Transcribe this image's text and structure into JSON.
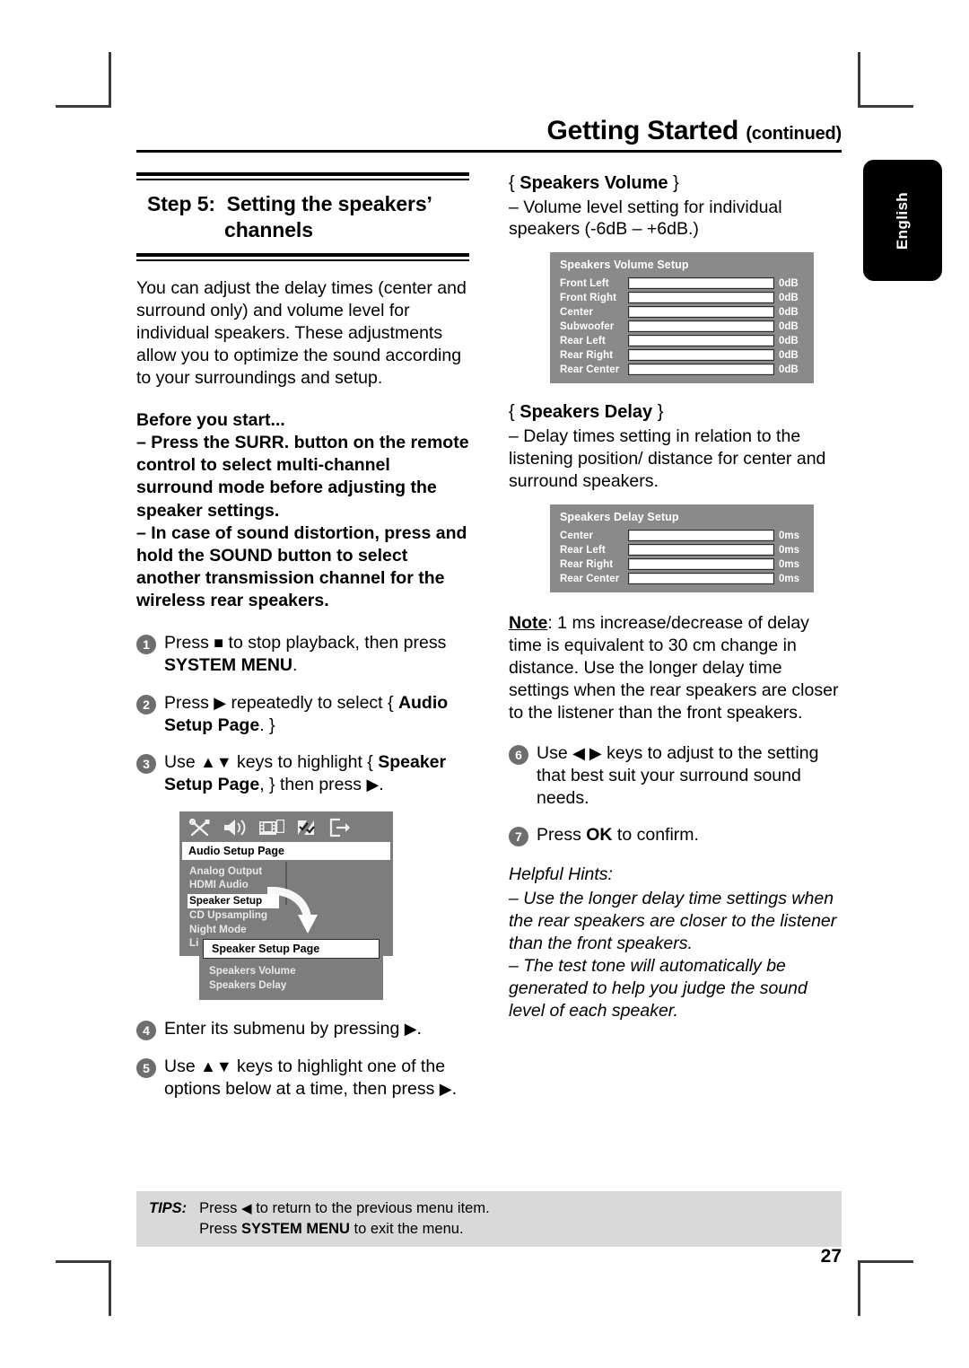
{
  "header": {
    "title": "Getting Started",
    "continued": "(continued)"
  },
  "language_tab": {
    "label": "English"
  },
  "left_column": {
    "step_title": {
      "prefix": "Step 5:",
      "line1": "Setting the speakers’",
      "line2": "channels"
    },
    "intro": "You can adjust the delay times (center and surround only) and volume level for individual speakers. These adjustments allow you to optimize the sound according to your surroundings and setup.",
    "before_you_start": {
      "heading": "Before you start...",
      "bullet1": "–  Press the SURR. button on the remote control to select multi-channel surround mode before adjusting the speaker settings.",
      "bullet2": "–  In case of sound distortion, press and hold the SOUND button to select another transmission channel for the wireless rear speakers."
    },
    "steps": [
      {
        "num": "1",
        "line1_pre": "Press ",
        "icon": "stop-square-icon",
        "line1_post": " to stop playback, then press",
        "line2_bold": "SYSTEM MENU",
        "line2_post": "."
      },
      {
        "num": "2",
        "line1_pre": "Press ",
        "icon": "right-arrow-icon",
        "line1_post": " repeatedly to select { ",
        "bold1": "Audio",
        "line2_bold": "Setup Page",
        "line2_post": ". }"
      },
      {
        "num": "3",
        "line1_pre": "Use ",
        "icon": "up-down-arrows-icon",
        "line1_post": " keys to highlight { ",
        "bold1": "Speaker",
        "line2_bold": "Setup Page",
        "line2_mid": ", } then press ",
        "line2_icon": "right-arrow-icon",
        "line2_post": "."
      },
      {
        "num": "4",
        "line1_pre": "Enter its submenu by pressing ",
        "icon": "right-arrow-icon",
        "line1_post": "."
      },
      {
        "num": "5",
        "line1_pre": "Use ",
        "icon": "up-down-arrows-icon",
        "line1_post": " keys to highlight one of the",
        "line2_pre": "options below at a time, then press ",
        "line2_icon": "right-arrow-icon",
        "line2_post": "."
      }
    ],
    "osd_audio_menu": {
      "icons": [
        "tools-icon",
        "speaker-icon",
        "filmstrip-icon",
        "preferences-icon",
        "exit-icon"
      ],
      "title": "Audio Setup Page",
      "items": [
        "Analog Output",
        "HDMI Audio",
        "Speaker Setup",
        "CD Upsampling",
        "Night Mode",
        "Lip Sync"
      ],
      "selected": "Speaker Setup",
      "submenu": {
        "title": "Speaker Setup Page",
        "items": [
          "Speakers Volume",
          "Speakers Delay"
        ]
      }
    }
  },
  "right_column": {
    "speakers_volume": {
      "heading_open": "{ ",
      "heading": "Speakers Volume",
      "heading_close": " }",
      "description": "–   Volume level setting for individual speakers (-6dB – +6dB.)",
      "panel": {
        "title": "Speakers Volume Setup",
        "rows": [
          {
            "label": "Front Left",
            "value": "0dB"
          },
          {
            "label": "Front Right",
            "value": "0dB"
          },
          {
            "label": "Center",
            "value": "0dB"
          },
          {
            "label": "Subwoofer",
            "value": "0dB"
          },
          {
            "label": "Rear Left",
            "value": "0dB"
          },
          {
            "label": "Rear Right",
            "value": "0dB"
          },
          {
            "label": "Rear Center",
            "value": "0dB"
          }
        ]
      }
    },
    "speakers_delay": {
      "heading_open": "{ ",
      "heading": "Speakers Delay",
      "heading_close": " }",
      "description": "–   Delay times setting in relation to the listening position/ distance for center and surround speakers.",
      "panel": {
        "title": "Speakers Delay Setup",
        "rows": [
          {
            "label": "Center",
            "value": "0ms"
          },
          {
            "label": "Rear Left",
            "value": "0ms"
          },
          {
            "label": "Rear Right",
            "value": "0ms"
          },
          {
            "label": "Rear Center",
            "value": "0ms"
          }
        ]
      }
    },
    "note": {
      "label": "Note",
      "text": ": 1 ms increase/decrease of delay time is equivalent to 30 cm change in distance.  Use the longer delay time settings when the rear speakers are closer to the listener than the front speakers."
    },
    "steps": [
      {
        "num": "6",
        "line1_pre": "Use ",
        "icon": "left-right-arrows-icon",
        "line1_post": " keys to adjust to the setting",
        "line2": "that best suit your surround sound needs."
      },
      {
        "num": "7",
        "line1_pre": "Press ",
        "bold1": "OK",
        "line1_post": " to confirm."
      }
    ],
    "helpful_hints": {
      "title": "Helpful Hints:",
      "hint1": "– Use the longer delay time settings when the rear speakers are closer to the listener than the front speakers.",
      "hint2": "– The test tone will automatically be generated to help you judge the sound level of each speaker."
    }
  },
  "tips": {
    "label": "TIPS:",
    "line1_pre": "Press ",
    "line1_icon": "left-arrow-icon",
    "line1_post": " to return to the previous menu item.",
    "line2_pre": "Press ",
    "line2_bold": "SYSTEM MENU",
    "line2_post": " to exit the menu."
  },
  "page_number": "27",
  "colors": {
    "osd_background": "#8a8a8a",
    "osd_menu_background": "#7d7d7d",
    "tips_background": "#d9d9d9",
    "step_bullet": "#6e6e6e"
  }
}
